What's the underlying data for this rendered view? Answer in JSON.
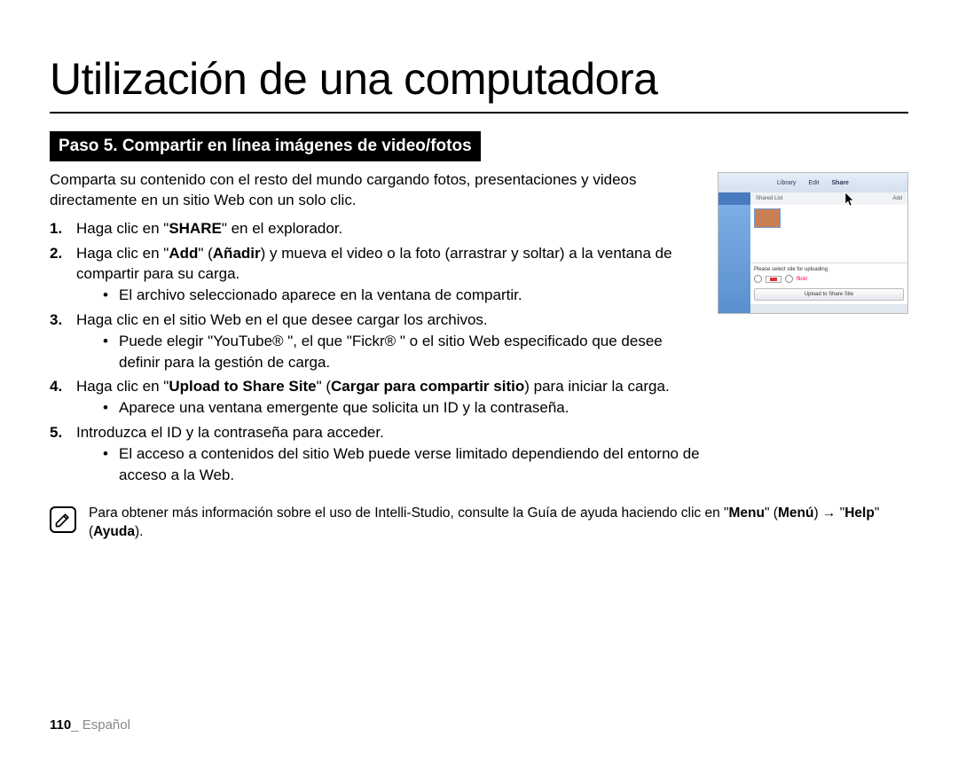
{
  "title": "Utilización de una computadora",
  "step_banner": "Paso 5. Compartir en línea imágenes de video/fotos",
  "intro": "Comparta su contenido con el resto del mundo cargando fotos, presentaciones y videos directamente en un sitio Web con un solo clic.",
  "steps": {
    "s1": {
      "pre": "Haga clic en \"",
      "bold": "SHARE",
      "post": "\" en el explorador."
    },
    "s2": {
      "pre": "Haga clic en \"",
      "b1": "Add",
      "mid1": "\" (",
      "b2": "Añadir",
      "post": ") y mueva el video o la foto (arrastrar y soltar) a la ventana de compartir para su carga.",
      "sub": "El archivo seleccionado aparece en la ventana de compartir."
    },
    "s3": {
      "text": "Haga clic en el sitio Web en el que desee cargar los archivos.",
      "sub": "Puede elegir \"YouTube® \", el que \"Fickr® \" o el sitio Web especificado que desee definir para la gestión de carga."
    },
    "s4": {
      "pre": "Haga clic en \"",
      "b1": "Upload to Share Site",
      "mid1": "\" (",
      "b2": "Cargar para compartir sitio",
      "post": ") para iniciar la carga.",
      "sub": "Aparece una ventana emergente que solicita un ID y la contraseña."
    },
    "s5": {
      "text": "Introduzca el ID y la contraseña para acceder.",
      "sub": "El acceso a contenidos del sitio Web puede verse limitado dependiendo del entorno de acceso a la Web."
    }
  },
  "note": {
    "pre": "Para obtener más información sobre el uso de Intelli-Studio, consulte la Guía de ayuda haciendo clic en \"",
    "b1": "Menu",
    "mid1": "\" (",
    "b2": "Menú",
    "mid2": ") → \"",
    "b3": "Help",
    "mid3": "\" (",
    "b4": "Ayuda",
    "post": ")."
  },
  "screenshot": {
    "tab_library": "Library",
    "tab_edit": "Edit",
    "tab_share": "Share",
    "upload_label": "Please select site for uploading",
    "upload_button": "Upload to Share Site"
  },
  "footer": {
    "page": "110",
    "sep": "_ ",
    "lang": "Español"
  }
}
